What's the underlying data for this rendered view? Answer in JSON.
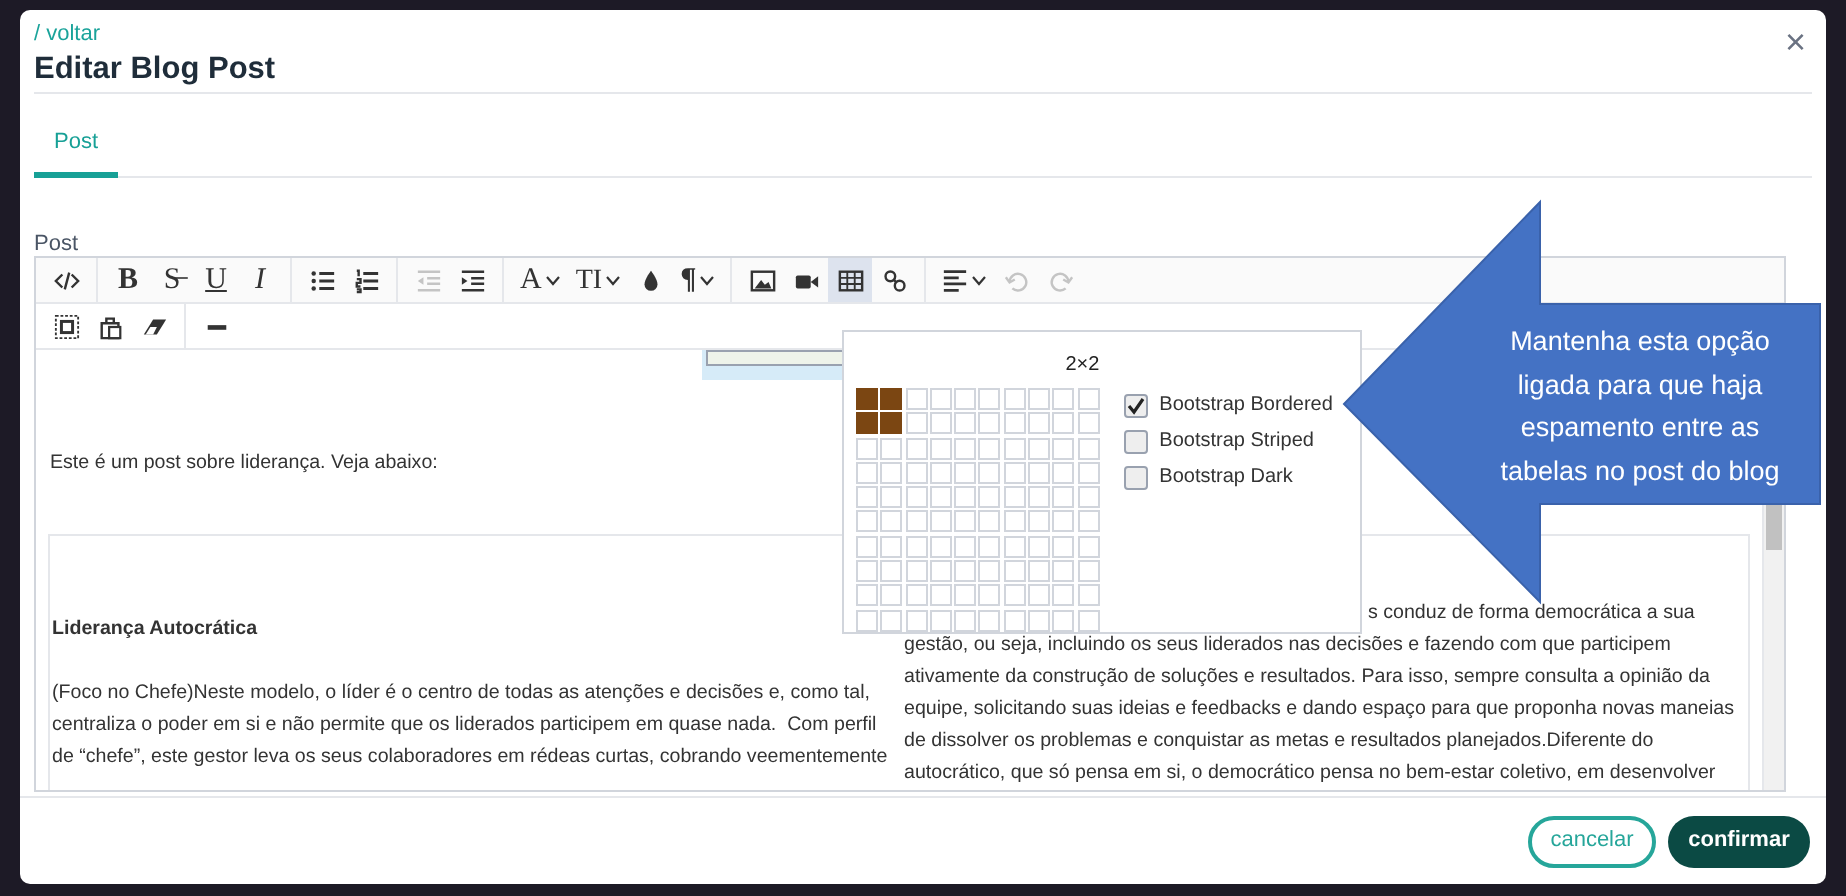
{
  "modal": {
    "back_link": "/ voltar",
    "title": "Editar Blog Post",
    "close": "×"
  },
  "tabs": [
    {
      "label": "Post",
      "selected": true
    }
  ],
  "editor": {
    "label": "Post",
    "toolbar": [
      [
        [
          {
            "kind": "code"
          }
        ],
        [
          {
            "kind": "bold",
            "label": "B"
          },
          {
            "kind": "strike",
            "label": "S̶"
          },
          {
            "kind": "underline",
            "label": "U"
          },
          {
            "kind": "italic",
            "label": "I"
          }
        ],
        [
          {
            "kind": "ul"
          },
          {
            "kind": "ol"
          }
        ],
        [
          {
            "kind": "outdent",
            "disabled": true
          },
          {
            "kind": "indent",
            "disabled": false
          }
        ],
        [
          {
            "kind": "font",
            "label": "A",
            "dropdown": true
          },
          {
            "kind": "fontsize",
            "label": "TI",
            "dropdown": true
          },
          {
            "kind": "color"
          },
          {
            "kind": "paragraph",
            "label": "¶",
            "dropdown": true
          }
        ],
        [
          {
            "kind": "image"
          },
          {
            "kind": "video"
          },
          {
            "kind": "table",
            "active": true
          },
          {
            "kind": "link"
          }
        ],
        [
          {
            "kind": "align",
            "dropdown": true
          },
          {
            "kind": "undo",
            "disabled": true
          },
          {
            "kind": "redo",
            "disabled": true
          }
        ]
      ],
      [
        [
          {
            "kind": "selectall"
          },
          {
            "kind": "paste"
          },
          {
            "kind": "eraser"
          }
        ],
        [
          {
            "kind": "hr"
          }
        ]
      ]
    ],
    "intro": "Este é um post sobre liderança. Veja abaixo:",
    "table": {
      "left": {
        "heading": "Liderança Autocrática",
        "text": "(Foco no Chefe)Neste modelo, o líder é o centro de todas as atenções e decisões e, como tal,\ncentraliza o poder em si e não permite que os liderados participem em quase nada.  Com perfil\nde “chefe”, este gestor leva os seus colaboradores em rédeas curtas, cobrando veementemente"
      },
      "right": {
        "fragment": "s conduz de forma democrática a sua",
        "text": "gestão, ou seja, incluindo os seus liderados nas decisões e fazendo com que participem\nativamente da construção de soluções e resultados. Para isso, sempre consulta a opinião da\nequipe, solicitando suas ideias e feedbacks e dando espaço para que proponha novas maneias\nde dissolver os problemas e conquistar as metas e resultados planejados.Diferente do\nautocrático, que só pensa em si, o democrático pensa no bem-estar coletivo, em desenvolver"
      }
    }
  },
  "table_popup": {
    "size": "2×2",
    "grid": [
      [
        true,
        true,
        false,
        false,
        false,
        false,
        false,
        false,
        false,
        false
      ],
      [
        true,
        true,
        false,
        false,
        false,
        false,
        false,
        false,
        false,
        false
      ],
      [
        false,
        false,
        false,
        false,
        false,
        false,
        false,
        false,
        false,
        false
      ],
      [
        false,
        false,
        false,
        false,
        false,
        false,
        false,
        false,
        false,
        false
      ],
      [
        false,
        false,
        false,
        false,
        false,
        false,
        false,
        false,
        false,
        false
      ],
      [
        false,
        false,
        false,
        false,
        false,
        false,
        false,
        false,
        false,
        false
      ],
      [
        false,
        false,
        false,
        false,
        false,
        false,
        false,
        false,
        false,
        false
      ],
      [
        false,
        false,
        false,
        false,
        false,
        false,
        false,
        false,
        false,
        false
      ],
      [
        false,
        false,
        false,
        false,
        false,
        false,
        false,
        false,
        false,
        false
      ],
      [
        false,
        false,
        false,
        false,
        false,
        false,
        false,
        false,
        false,
        false
      ]
    ],
    "options": [
      {
        "label": "Bootstrap Bordered",
        "checked": true
      },
      {
        "label": "Bootstrap Striped",
        "checked": false
      },
      {
        "label": "Bootstrap Dark",
        "checked": false
      }
    ]
  },
  "callout": {
    "text": "Mantenha esta opção\nligada para que haja\nespamento entre as\ntabelas no post do blog"
  },
  "footer": {
    "buttons": [
      {
        "label": "cancelar",
        "kind": "secondary"
      },
      {
        "label": "confirmar",
        "kind": "primary"
      }
    ]
  }
}
